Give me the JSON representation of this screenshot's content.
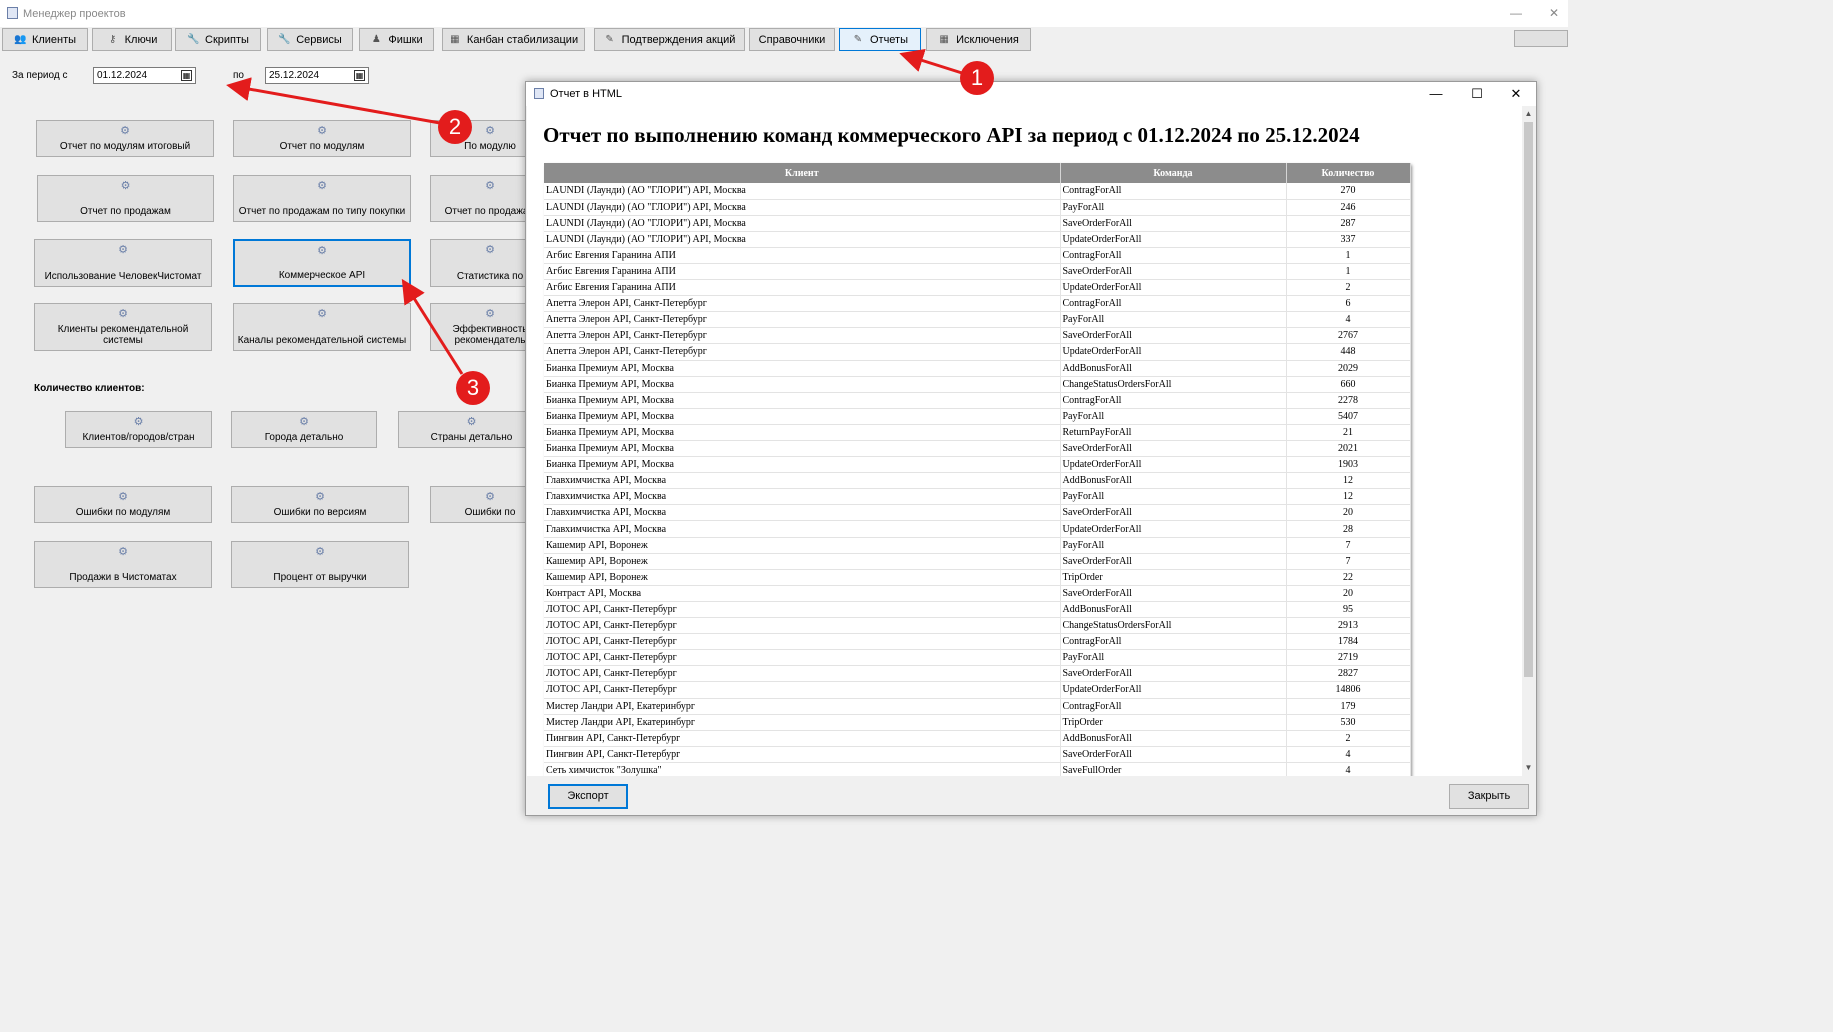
{
  "window": {
    "title": "Менеджер проектов",
    "minimize": "—",
    "close": "✕"
  },
  "tabs": [
    {
      "label": "Клиенты",
      "icon": "clients-icon",
      "glyph": "👥"
    },
    {
      "label": "Ключи",
      "icon": "key-icon",
      "glyph": "⚷"
    },
    {
      "label": "Скрипты",
      "icon": "wrench-icon",
      "glyph": "🔧"
    },
    {
      "label": "Сервисы",
      "icon": "wrench-icon",
      "glyph": "🔧"
    },
    {
      "label": "Фишки",
      "icon": "chips-icon",
      "glyph": "♟"
    },
    {
      "label": "Канбан стабилизации",
      "icon": "kanban-icon",
      "glyph": "▦"
    },
    {
      "label": "Подтверждения акций",
      "icon": "pencil-icon",
      "glyph": "✎"
    },
    {
      "label": "Справочники",
      "icon": "",
      "glyph": ""
    },
    {
      "label": "Отчеты",
      "icon": "report-icon",
      "glyph": "✎"
    },
    {
      "label": "Исключения",
      "icon": "calendar-icon",
      "glyph": "▦"
    }
  ],
  "active_tab": "Отчеты",
  "period": {
    "from_label": "За период с",
    "from_value": "01.12.2024",
    "to_label": "по",
    "to_value": "25.12.2024"
  },
  "report_buttons": [
    "Отчет по модулям итоговый",
    "Отчет по модулям",
    "По модулю",
    "Отчет по продажам",
    "Отчет по продажам по типу покупки",
    "Отчет по продажам",
    "Использование ЧеловекЧистомат",
    "Коммерческое API",
    "Статистика по",
    "Клиенты рекомендательной системы",
    "Каналы рекомендательной системы",
    "Эффективность рекомендатель"
  ],
  "clients_section_label": "Количество клиентов:",
  "clients_buttons": [
    "Клиентов/городов/стран",
    "Города детально",
    "Страны детально"
  ],
  "bottom_buttons": [
    "Ошибки по модулям",
    "Ошибки по версиям",
    "Ошибки по",
    "Продажи в Чистоматах",
    "Процент от выручки"
  ],
  "selected_button": "Коммерческое API",
  "callouts": [
    "1",
    "2",
    "3"
  ],
  "accent_color": "#0078d7",
  "callout_color": "#e31c1c",
  "dialog": {
    "title": "Отчет в HTML",
    "minimize": "—",
    "maximize": "☐",
    "close": "✕",
    "report_title": "Отчет по выполнению команд коммерческого API за период с 01.12.2024 по 25.12.2024",
    "columns": [
      "Клиент",
      "Команда",
      "Количество"
    ],
    "rows": [
      [
        "LAUNDI (Лаунди) (АО \"ГЛОРИ\") API, Москва",
        "ContragForAll",
        "270"
      ],
      [
        "LAUNDI (Лаунди) (АО \"ГЛОРИ\") API, Москва",
        "PayForAll",
        "246"
      ],
      [
        "LAUNDI (Лаунди) (АО \"ГЛОРИ\") API, Москва",
        "SaveOrderForAll",
        "287"
      ],
      [
        "LAUNDI (Лаунди) (АО \"ГЛОРИ\") API, Москва",
        "UpdateOrderForAll",
        "337"
      ],
      [
        "Агбис Евгения Гаранина АПИ",
        "ContragForAll",
        "1"
      ],
      [
        "Агбис Евгения Гаранина АПИ",
        "SaveOrderForAll",
        "1"
      ],
      [
        "Агбис Евгения Гаранина АПИ",
        "UpdateOrderForAll",
        "2"
      ],
      [
        "Апетта Элерон API, Санкт-Петербург",
        "ContragForAll",
        "6"
      ],
      [
        "Апетта Элерон API, Санкт-Петербург",
        "PayForAll",
        "4"
      ],
      [
        "Апетта Элерон API, Санкт-Петербург",
        "SaveOrderForAll",
        "2767"
      ],
      [
        "Апетта Элерон API, Санкт-Петербург",
        "UpdateOrderForAll",
        "448"
      ],
      [
        "Бианка Премиум API, Москва",
        "AddBonusForAll",
        "2029"
      ],
      [
        "Бианка Премиум API, Москва",
        "ChangeStatusOrdersForAll",
        "660"
      ],
      [
        "Бианка Премиум API, Москва",
        "ContragForAll",
        "2278"
      ],
      [
        "Бианка Премиум API, Москва",
        "PayForAll",
        "5407"
      ],
      [
        "Бианка Премиум API, Москва",
        "ReturnPayForAll",
        "21"
      ],
      [
        "Бианка Премиум API, Москва",
        "SaveOrderForAll",
        "2021"
      ],
      [
        "Бианка Премиум API, Москва",
        "UpdateOrderForAll",
        "1903"
      ],
      [
        "Главхимчистка API, Москва",
        "AddBonusForAll",
        "12"
      ],
      [
        "Главхимчистка API, Москва",
        "PayForAll",
        "12"
      ],
      [
        "Главхимчистка API, Москва",
        "SaveOrderForAll",
        "20"
      ],
      [
        "Главхимчистка API, Москва",
        "UpdateOrderForAll",
        "28"
      ],
      [
        "Кашемир API, Воронеж",
        "PayForAll",
        "7"
      ],
      [
        "Кашемир API, Воронеж",
        "SaveOrderForAll",
        "7"
      ],
      [
        "Кашемир API, Воронеж",
        "TripOrder",
        "22"
      ],
      [
        "Контраст API, Москва",
        "SaveOrderForAll",
        "20"
      ],
      [
        "ЛОТОС API, Санкт-Петербург",
        "AddBonusForAll",
        "95"
      ],
      [
        "ЛОТОС API, Санкт-Петербург",
        "ChangeStatusOrdersForAll",
        "2913"
      ],
      [
        "ЛОТОС API, Санкт-Петербург",
        "ContragForAll",
        "1784"
      ],
      [
        "ЛОТОС API, Санкт-Петербург",
        "PayForAll",
        "2719"
      ],
      [
        "ЛОТОС API, Санкт-Петербург",
        "SaveOrderForAll",
        "2827"
      ],
      [
        "ЛОТОС API, Санкт-Петербург",
        "UpdateOrderForAll",
        "14806"
      ],
      [
        "Мистер Ландри API, Екатеринбург",
        "ContragForAll",
        "179"
      ],
      [
        "Мистер Ландри API, Екатеринбург",
        "TripOrder",
        "530"
      ],
      [
        "Пингвин API, Санкт-Петербург",
        "AddBonusForAll",
        "2"
      ],
      [
        "Пингвин API, Санкт-Петербург",
        "SaveOrderForAll",
        "4"
      ],
      [
        "Сеть химчисток \"Золушка\"",
        "SaveFullOrder",
        "4"
      ]
    ],
    "export_label": "Экспорт",
    "close_label": "Закрыть"
  }
}
